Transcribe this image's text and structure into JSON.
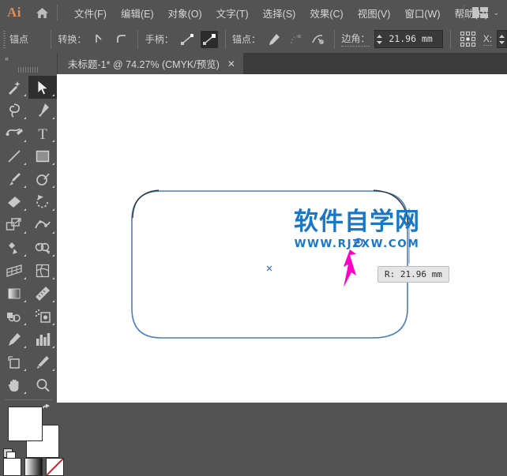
{
  "app": {
    "logo_text": "Ai",
    "home_icon": "home-icon",
    "workspace_icon": "workspace-layout-icon",
    "workspace_chevron": "⌄"
  },
  "menubar": {
    "items": [
      {
        "label": "文件(F)",
        "name": "menu-file"
      },
      {
        "label": "编辑(E)",
        "name": "menu-edit"
      },
      {
        "label": "对象(O)",
        "name": "menu-object"
      },
      {
        "label": "文字(T)",
        "name": "menu-type"
      },
      {
        "label": "选择(S)",
        "name": "menu-select"
      },
      {
        "label": "效果(C)",
        "name": "menu-effect"
      },
      {
        "label": "视图(V)",
        "name": "menu-view"
      },
      {
        "label": "窗口(W)",
        "name": "menu-window"
      },
      {
        "label": "帮助(H)",
        "name": "menu-help"
      }
    ]
  },
  "optionsbar": {
    "title": "锚点",
    "convert_label": "转换：",
    "convert_corner_icon": "convert-to-corner-icon",
    "convert_smooth_icon": "convert-to-smooth-icon",
    "handles_label": "手柄：",
    "handle_show_icon": "show-handles-icon",
    "handle_hide_icon": "hide-handles-icon",
    "anchor_label": "锚点：",
    "anchor_remove_icon": "remove-anchor-icon",
    "anchor_connect_icon": "connect-anchor-icon",
    "anchor_cut_icon": "cut-path-icon",
    "corner_label": "边角：",
    "corner_value": "21.96 mm",
    "align_grid_icon": "anchor-reference-grid-icon",
    "x_label": "X:"
  },
  "tabbar": {
    "tab_title": "未标题-1* @ 74.27% (CMYK/预览)",
    "close_glyph": "✕"
  },
  "toolpanel": {
    "collapse_glyph": "«",
    "tools": [
      {
        "name": "magic-wand-tool",
        "selected": false
      },
      {
        "name": "selection-tool",
        "selected": true
      },
      {
        "name": "lasso-tool",
        "selected": false
      },
      {
        "name": "pen-tool",
        "selected": false
      },
      {
        "name": "curvature-tool",
        "selected": false
      },
      {
        "name": "type-tool",
        "selected": false
      },
      {
        "name": "line-segment-tool",
        "selected": false
      },
      {
        "name": "rectangle-tool",
        "selected": false
      },
      {
        "name": "paintbrush-tool",
        "selected": false
      },
      {
        "name": "shaper-tool",
        "selected": false
      },
      {
        "name": "eraser-tool",
        "selected": false
      },
      {
        "name": "rotate-tool",
        "selected": false
      },
      {
        "name": "scale-tool",
        "selected": false
      },
      {
        "name": "width-tool",
        "selected": false
      },
      {
        "name": "free-transform-tool",
        "selected": false
      },
      {
        "name": "shape-builder-tool",
        "selected": false
      },
      {
        "name": "perspective-grid-tool",
        "selected": false
      },
      {
        "name": "mesh-tool",
        "selected": false
      },
      {
        "name": "gradient-tool",
        "selected": false
      },
      {
        "name": "eyedropper-tool",
        "selected": false
      },
      {
        "name": "blend-tool",
        "selected": false
      },
      {
        "name": "symbol-sprayer-tool",
        "selected": false
      },
      {
        "name": "column-graph-tool",
        "selected": false
      },
      {
        "name": "artboard-tool",
        "selected": false
      },
      {
        "name": "slice-tool",
        "selected": false
      },
      {
        "name": "hand-tool",
        "selected": false
      },
      {
        "name": "zoom-tool",
        "selected": false
      }
    ],
    "fill_color": "#ffffff",
    "stroke_color": "#000000",
    "swap_icon": "swap-fill-stroke-icon",
    "default_icon": "default-fill-stroke-icon",
    "fs_buttons": [
      {
        "name": "color-button"
      },
      {
        "name": "gradient-button"
      },
      {
        "name": "none-button"
      }
    ]
  },
  "canvas": {
    "shape_name": "rounded-rectangle",
    "shape_stroke_color": "#4a7ebb",
    "live_corner_color": "#3b6fc4",
    "preview_corner_color": "#2a2a2a",
    "center_marker": "×",
    "corner_widget_name": "live-corner-widget",
    "pointer_arrow_color": "#ff00c8",
    "tooltip_text": "R: 21.96 mm",
    "watermark_cn": "软件自学网",
    "watermark_en": "WWW.RJZXW.COM",
    "watermark_color": "#1877c9"
  }
}
